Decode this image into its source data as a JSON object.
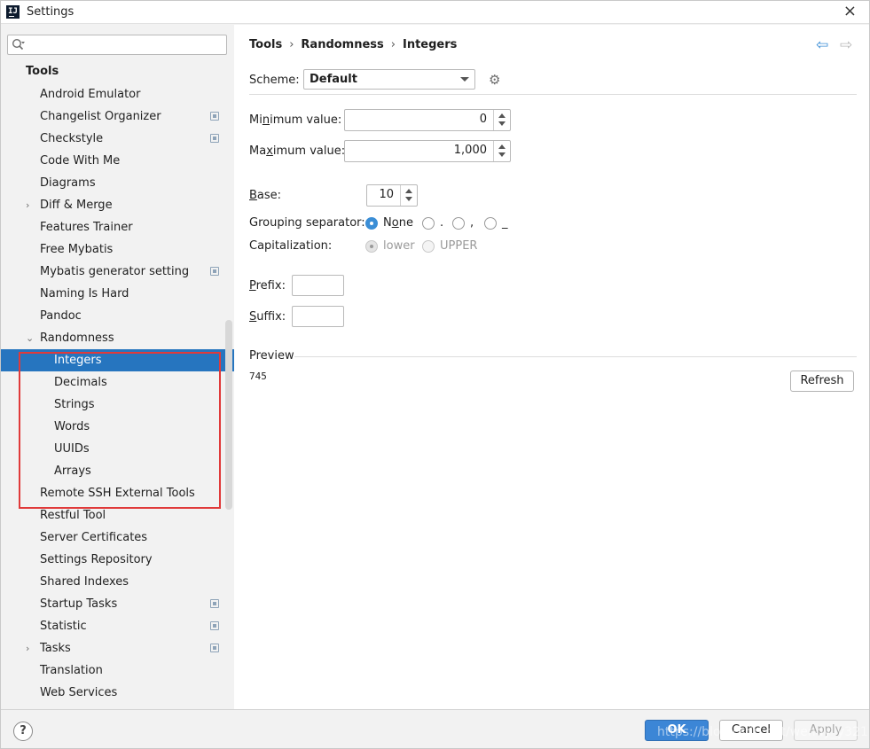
{
  "window": {
    "title": "Settings",
    "close_glyph": "×"
  },
  "sidebar": {
    "search_placeholder": "",
    "section_header": "Tools",
    "items": [
      {
        "label": "Android Emulator",
        "level": 0,
        "arrow": "",
        "project_icon": false
      },
      {
        "label": "Changelist Organizer",
        "level": 0,
        "arrow": "",
        "project_icon": true
      },
      {
        "label": "Checkstyle",
        "level": 0,
        "arrow": "",
        "project_icon": true
      },
      {
        "label": "Code With Me",
        "level": 0,
        "arrow": "",
        "project_icon": false
      },
      {
        "label": "Diagrams",
        "level": 0,
        "arrow": "",
        "project_icon": false
      },
      {
        "label": "Diff & Merge",
        "level": 0,
        "arrow": "›",
        "project_icon": false
      },
      {
        "label": "Features Trainer",
        "level": 0,
        "arrow": "",
        "project_icon": false
      },
      {
        "label": "Free Mybatis",
        "level": 0,
        "arrow": "",
        "project_icon": false
      },
      {
        "label": "Mybatis generator setting",
        "level": 0,
        "arrow": "",
        "project_icon": true
      },
      {
        "label": "Naming Is Hard",
        "level": 0,
        "arrow": "",
        "project_icon": false
      },
      {
        "label": "Pandoc",
        "level": 0,
        "arrow": "",
        "project_icon": false
      },
      {
        "label": "Randomness",
        "level": 0,
        "arrow": "⌄",
        "project_icon": false
      },
      {
        "label": "Integers",
        "level": 1,
        "arrow": "",
        "project_icon": false,
        "selected": true
      },
      {
        "label": "Decimals",
        "level": 1,
        "arrow": "",
        "project_icon": false
      },
      {
        "label": "Strings",
        "level": 1,
        "arrow": "",
        "project_icon": false
      },
      {
        "label": "Words",
        "level": 1,
        "arrow": "",
        "project_icon": false
      },
      {
        "label": "UUIDs",
        "level": 1,
        "arrow": "",
        "project_icon": false
      },
      {
        "label": "Arrays",
        "level": 1,
        "arrow": "",
        "project_icon": false
      },
      {
        "label": "Remote SSH External Tools",
        "level": 0,
        "arrow": "",
        "project_icon": false
      },
      {
        "label": "Restful Tool",
        "level": 0,
        "arrow": "",
        "project_icon": false
      },
      {
        "label": "Server Certificates",
        "level": 0,
        "arrow": "",
        "project_icon": false
      },
      {
        "label": "Settings Repository",
        "level": 0,
        "arrow": "",
        "project_icon": false
      },
      {
        "label": "Shared Indexes",
        "level": 0,
        "arrow": "",
        "project_icon": false
      },
      {
        "label": "Startup Tasks",
        "level": 0,
        "arrow": "",
        "project_icon": true
      },
      {
        "label": "Statistic",
        "level": 0,
        "arrow": "",
        "project_icon": true
      },
      {
        "label": "Tasks",
        "level": 0,
        "arrow": "›",
        "project_icon": true
      },
      {
        "label": "Translation",
        "level": 0,
        "arrow": "",
        "project_icon": false
      },
      {
        "label": "Web Services",
        "level": 0,
        "arrow": "",
        "project_icon": false
      }
    ]
  },
  "main": {
    "breadcrumb": [
      "Tools",
      "Randomness",
      "Integers"
    ],
    "breadcrumb_sep": "›",
    "nav_back": "⇦",
    "nav_forward": "⇨",
    "scheme_label": "Scheme:",
    "scheme_value": "Default",
    "gear_glyph": "⚙",
    "min_label": {
      "pre": "Mi",
      "mn": "n",
      "post": "imum value:"
    },
    "min_value": "0",
    "max_label": {
      "pre": "Ma",
      "mn": "x",
      "post": "imum value:"
    },
    "max_value": "1,000",
    "base_label": {
      "mn": "B",
      "post": "ase:"
    },
    "base_value": "10",
    "grouping_label": "Grouping separator:",
    "grouping_options": [
      {
        "label": "None",
        "mn_index": 1,
        "selected": true
      },
      {
        "label": ".",
        "selected": false
      },
      {
        "label": ",",
        "selected": false
      },
      {
        "label": "_",
        "selected": false
      }
    ],
    "capitalization_label": "Capitalization:",
    "capitalization_options": [
      {
        "label": "lower",
        "selected": true,
        "disabled": true
      },
      {
        "label": "UPPER",
        "selected": false,
        "disabled": true
      }
    ],
    "prefix_label": {
      "mn": "P",
      "post": "refix:"
    },
    "prefix_value": "",
    "suffix_label": {
      "mn": "S",
      "post": "uffix:"
    },
    "suffix_value": "",
    "preview_label": "Preview",
    "preview_value": "745",
    "refresh_label": "Refresh"
  },
  "footer": {
    "help_glyph": "?",
    "ok_label": "OK",
    "cancel_label": "Cancel",
    "apply_label": "Apply",
    "watermark": "https://blog.csdn.net/wendy_y321"
  },
  "colors": {
    "accent": "#2675bf",
    "highlight_box": "#e03a3a",
    "ok_button": "#3c86d6"
  }
}
